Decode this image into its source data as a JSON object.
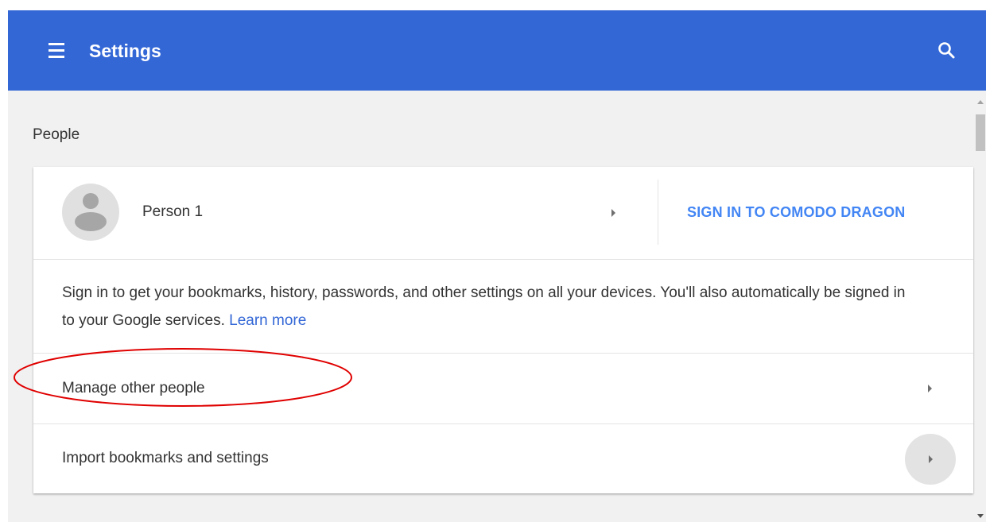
{
  "app_bar": {
    "title": "Settings",
    "menu_icon": "hamburger-menu-icon",
    "search_icon": "search-icon",
    "color": "#3367d6"
  },
  "section": {
    "title": "People"
  },
  "profile": {
    "name": "Person 1",
    "avatar_icon": "default-avatar-icon",
    "sign_in_label": "SIGN IN TO COMODO DRAGON",
    "accent_color": "#4285f4"
  },
  "description": {
    "text": "Sign in to get your bookmarks, history, passwords, and other settings on all your devices. You'll also automatically be signed in to your Google services.",
    "learn_more": "Learn more"
  },
  "rows": {
    "manage_other_people": "Manage other people",
    "import_bookmarks": "Import bookmarks and settings"
  },
  "annotation": {
    "color": "#e00000",
    "shape": "ellipse"
  }
}
